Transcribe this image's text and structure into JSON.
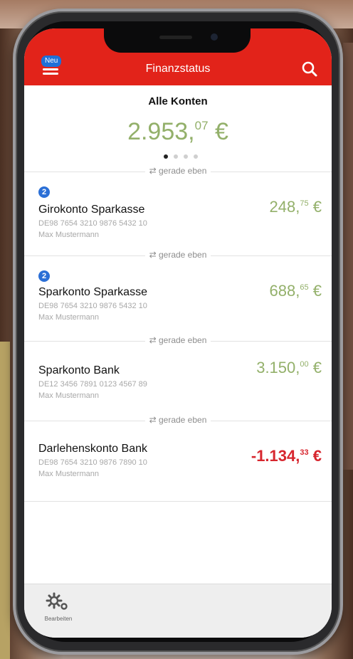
{
  "header": {
    "badge": "Neu",
    "title": "Finanzstatus"
  },
  "summary": {
    "label": "Alle Konten",
    "amount_main": "2.953,",
    "amount_cents": "07",
    "currency": "€"
  },
  "pager": {
    "count": 4,
    "active": 1
  },
  "sync_label": "gerade eben",
  "accounts": [
    {
      "badge": "2",
      "name": "Girokonto Sparkasse",
      "iban": "DE98 7654 3210 9876 5432 10",
      "owner": "Max Mustermann",
      "amount_main": "248,",
      "amount_cents": "75",
      "currency": "€",
      "negative": false
    },
    {
      "badge": "2",
      "name": "Sparkonto Sparkasse",
      "iban": "DE98 7654 3210 9876 5432 10",
      "owner": "Max Mustermann",
      "amount_main": "688,",
      "amount_cents": "65",
      "currency": "€",
      "negative": false
    },
    {
      "badge": "",
      "name": "Sparkonto Bank",
      "iban": "DE12 3456 7891 0123 4567 89",
      "owner": "Max Mustermann",
      "amount_main": "3.150,",
      "amount_cents": "00",
      "currency": "€",
      "negative": false
    },
    {
      "badge": "",
      "name": "Darlehenskonto Bank",
      "iban": "DE98 7654 3210 9876 7890 10",
      "owner": "Max Mustermann",
      "amount_main": "-1.134,",
      "amount_cents": "33",
      "currency": "€",
      "negative": true
    }
  ],
  "tabbar": {
    "edit_label": "Bearbeiten"
  },
  "colors": {
    "brand_red": "#e2231a",
    "positive": "#93b06a",
    "negative": "#d7262e",
    "badge_blue": "#2b6fd6"
  },
  "icons": {
    "menu": "hamburger-icon",
    "search": "search-icon",
    "sync": "sync-icon",
    "settings": "gear-icon"
  }
}
